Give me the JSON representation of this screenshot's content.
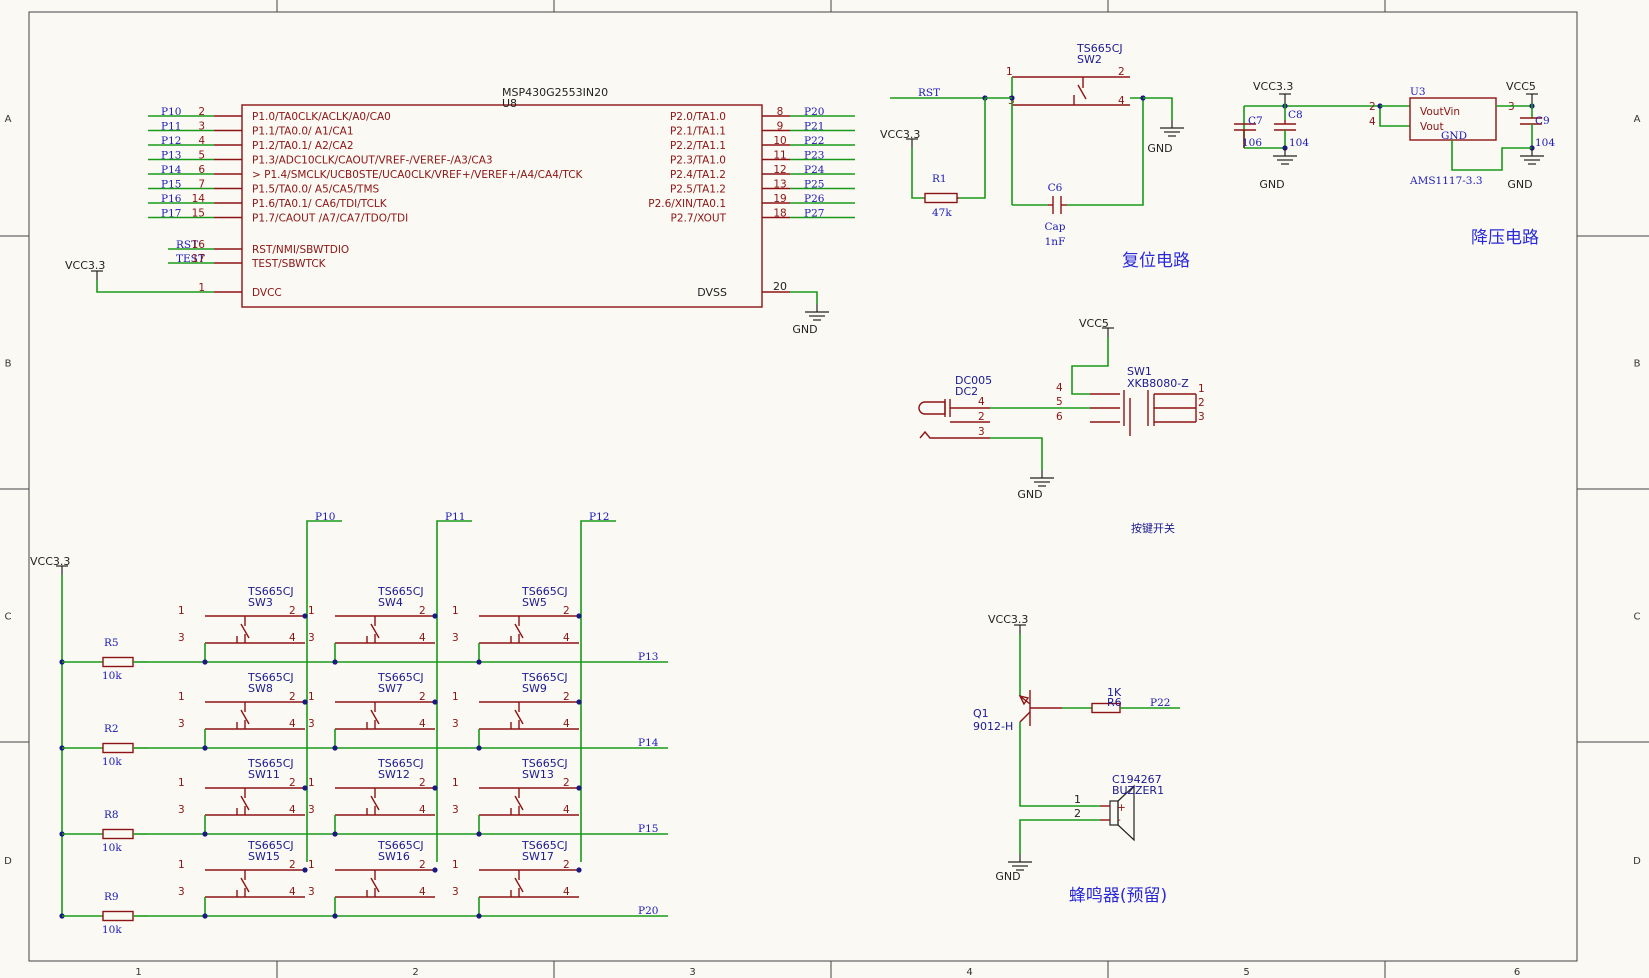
{
  "zones": {
    "cols": [
      "1",
      "2",
      "3",
      "4",
      "5",
      "6"
    ],
    "rows": [
      "A",
      "B",
      "C",
      "D"
    ]
  },
  "mcu": {
    "designator": "U8",
    "part": "MSP430G2553IN20",
    "left_pins": [
      {
        "net": "P10",
        "num": "2",
        "name": "P1.0/TA0CLK/ACLK/A0/CA0"
      },
      {
        "net": "P11",
        "num": "3",
        "name": "P1.1/TA0.0/ A1/CA1"
      },
      {
        "net": "P12",
        "num": "4",
        "name": "P1.2/TA0.1/ A2/CA2"
      },
      {
        "net": "P13",
        "num": "5",
        "name": "P1.3/ADC10CLK/CAOUT/VREF-/VEREF-/A3/CA3"
      },
      {
        "net": "P14",
        "num": "6",
        "name": "P1.4/SMCLK/UCB0STE/UCA0CLK/VREF+/VEREF+/A4/CA4/TCK"
      },
      {
        "net": "P15",
        "num": "7",
        "name": "P1.5/TA0.0/ A5/CA5/TMS"
      },
      {
        "net": "P16",
        "num": "14",
        "name": "P1.6/TA0.1/ CA6/TDI/TCLK"
      },
      {
        "net": "P17",
        "num": "15",
        "name": "P1.7/CAOUT /A7/CA7/TDO/TDI"
      }
    ],
    "right_pins": [
      {
        "net": "P20",
        "num": "8",
        "name": "P2.0/TA1.0"
      },
      {
        "net": "P21",
        "num": "9",
        "name": "P2.1/TA1.1"
      },
      {
        "net": "P22",
        "num": "10",
        "name": "P2.2/TA1.1"
      },
      {
        "net": "P23",
        "num": "11",
        "name": "P2.3/TA1.0"
      },
      {
        "net": "P24",
        "num": "12",
        "name": "P2.4/TA1.2"
      },
      {
        "net": "P25",
        "num": "13",
        "name": "P2.5/TA1.2"
      },
      {
        "net": "P26",
        "num": "19",
        "name": "P2.6/XIN/TA0.1"
      },
      {
        "net": "P27",
        "num": "18",
        "name": "P2.7/XOUT"
      }
    ],
    "rst": {
      "net": "RST",
      "num": "16",
      "name": "RST/NMI/SBWTDIO"
    },
    "test": {
      "net": "TEST",
      "num": "17",
      "name": "TEST/SBWTCK"
    },
    "dvcc": {
      "net": "VCC3.3",
      "num": "1",
      "name": "DVCC"
    },
    "dvss": {
      "net": "GND",
      "num": "20",
      "name": "DVSS"
    }
  },
  "reset": {
    "sw_part": "TS665CJ",
    "sw_des": "SW2",
    "net": "RST",
    "vcc": "VCC3.3",
    "gnd": "GND",
    "r_des": "R1",
    "r_val": "47k",
    "c_des": "C6",
    "c_type": "Cap",
    "c_val": "1nF",
    "pins": [
      "1",
      "2",
      "3",
      "4"
    ],
    "title": "复位电路"
  },
  "regulator": {
    "vin": "VCC3.3",
    "vout": "VCC5",
    "u_des": "U3",
    "u_part": "AMS1117-3.3",
    "pin_vout_vin": "VoutVin",
    "pin_vout": "Vout",
    "pin_gnd": "GND",
    "pins": [
      "2",
      "4",
      "3"
    ],
    "c7": "C7",
    "c7v": "106",
    "c8": "C8",
    "c8v": "104",
    "c9": "C9",
    "c9v": "104",
    "gnd": "GND",
    "title": "降压电路"
  },
  "power_switch": {
    "vcc": "VCC5",
    "dc_part": "DC005",
    "dc_des": "DC2",
    "sw_des": "SW1",
    "sw_part": "XKB8080-Z",
    "pins_left": [
      "4",
      "2",
      "3"
    ],
    "pins_mid": [
      "4",
      "5",
      "6"
    ],
    "pins_right": [
      "1",
      "2",
      "3"
    ],
    "gnd": "GND",
    "title": "按键开关"
  },
  "buzzer": {
    "vcc": "VCC3.3",
    "q_des": "Q1",
    "q_part": "9012-H",
    "r_val": "1K",
    "r_des": "R6",
    "net": "P22",
    "bz_code": "C194267",
    "bz_des": "BUZZER1",
    "pins": [
      "1",
      "2"
    ],
    "plus": "+",
    "minus": "-",
    "gnd": "GND",
    "title": "蜂鸣器(预留)"
  },
  "keypad": {
    "vcc": "VCC3.3",
    "col_nets": [
      "P10",
      "P11",
      "P12"
    ],
    "row_nets": [
      "P13",
      "P14",
      "P15",
      "P20"
    ],
    "resistors": [
      {
        "des": "R5",
        "val": "10k"
      },
      {
        "des": "R2",
        "val": "10k"
      },
      {
        "des": "R8",
        "val": "10k"
      },
      {
        "des": "R9",
        "val": "10k"
      }
    ],
    "switch_part": "TS665CJ",
    "switches": [
      [
        "SW3",
        "SW4",
        "SW5"
      ],
      [
        "SW8",
        "SW7",
        "SW9"
      ],
      [
        "SW11",
        "SW12",
        "SW13"
      ],
      [
        "SW15",
        "SW16",
        "SW17"
      ]
    ],
    "pins": [
      "1",
      "2",
      "3",
      "4"
    ]
  }
}
